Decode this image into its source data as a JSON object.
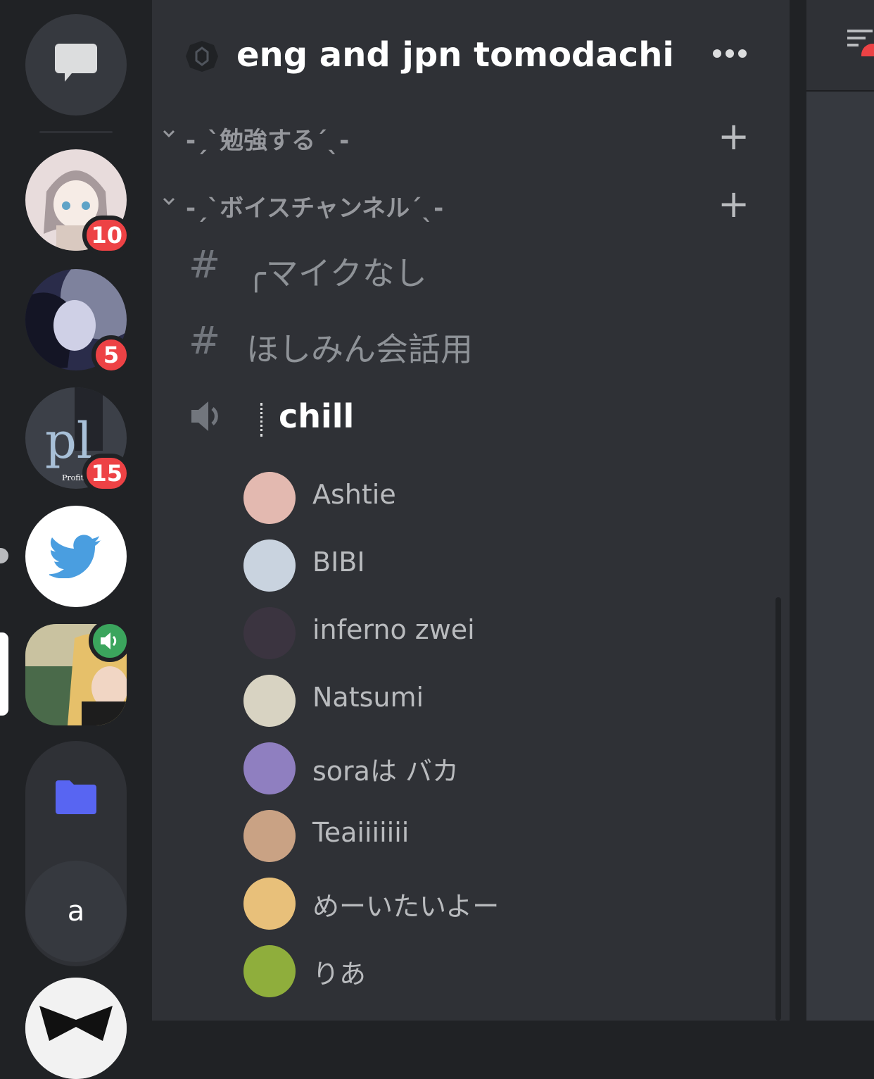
{
  "guilds": {
    "dm_icon": "chat-bubble-icon",
    "servers": [
      {
        "name": "anime-girl-server",
        "badge": "10"
      },
      {
        "name": "dark-anime-server",
        "badge": "5"
      },
      {
        "name": "profit-server",
        "badge": "15"
      },
      {
        "name": "twitter-server",
        "badge": ""
      },
      {
        "name": "active-voice-server",
        "badge": ""
      }
    ],
    "folder_icon": "folder-icon",
    "letter_server": "a"
  },
  "header": {
    "server_name": "eng and jpn tomodachi",
    "more_icon": "more-dots-icon"
  },
  "categories": [
    {
      "name": "-ˏˋ勉強するˊˎ-",
      "add": "+"
    },
    {
      "name": "-ˏˋボイスチャンネルˊˎ-",
      "add": "+"
    }
  ],
  "channels": [
    {
      "name": "╭マイクなし",
      "type": "text"
    },
    {
      "name": "ほしみん会話用",
      "type": "text"
    },
    {
      "name": "chill",
      "type": "voice"
    }
  ],
  "hash_symbol": "#",
  "voice_users": [
    {
      "name": "Ashtie",
      "color": "#e3b9b0"
    },
    {
      "name": "BIBI",
      "color": "#c9d3df"
    },
    {
      "name": "inferno zwei",
      "color": "#3b3440"
    },
    {
      "name": "Natsumi",
      "color": "#d8d3c2"
    },
    {
      "name": "soraは バカ",
      "color": "#8f7fc0"
    },
    {
      "name": "Teaiiiiiii",
      "color": "#c9a284"
    },
    {
      "name": "めーいたいよー",
      "color": "#e8c07a"
    },
    {
      "name": "りあ",
      "color": "#8fae3c"
    }
  ],
  "colors": {
    "accent_red": "#ed4245",
    "voice_green": "#3ba55d",
    "folder_blue": "#5865f2"
  }
}
